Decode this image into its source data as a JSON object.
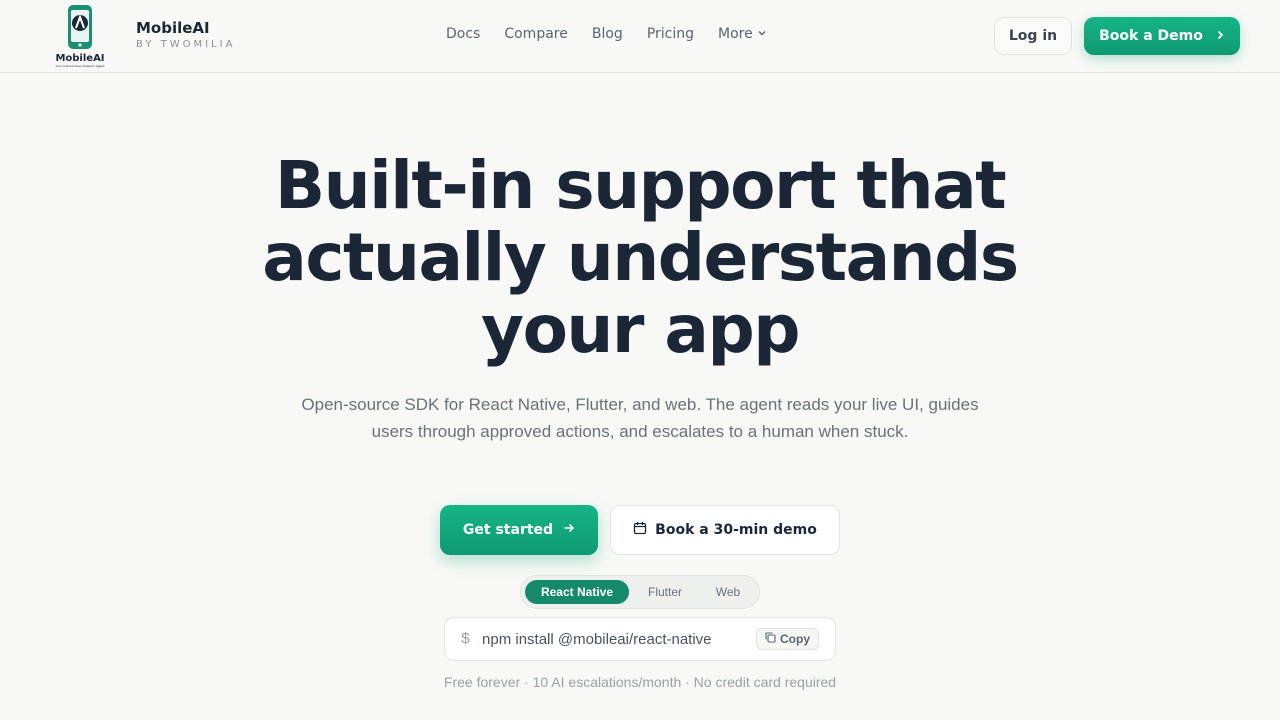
{
  "brand": {
    "name": "MobileAI",
    "subtitle": "BY TWOMILIA",
    "logo_text": "MobileAI",
    "logo_tagline": "Your Autonomous Support Agent",
    "accent": "#10a37a"
  },
  "nav": {
    "links": [
      {
        "label": "Docs"
      },
      {
        "label": "Compare"
      },
      {
        "label": "Blog"
      },
      {
        "label": "Pricing"
      },
      {
        "label": "More"
      }
    ],
    "login_label": "Log in",
    "demo_label": "Book a Demo"
  },
  "hero": {
    "title": "Built-in support that actually understands your app",
    "subtitle": "Open-source SDK for React Native, Flutter, and web. The agent reads your live UI, guides users through approved actions, and escalates to a human when stuck.",
    "primary_cta": "Get started",
    "secondary_cta": "Book a 30-min demo"
  },
  "platform_tabs": [
    {
      "label": "React Native",
      "active": true
    },
    {
      "label": "Flutter",
      "active": false
    },
    {
      "label": "Web",
      "active": false
    }
  ],
  "install": {
    "prompt": "$",
    "command": "npm install @mobileai/react-native",
    "copy_label": "Copy"
  },
  "footnote": "Free forever · 10 AI escalations/month · No credit card required"
}
